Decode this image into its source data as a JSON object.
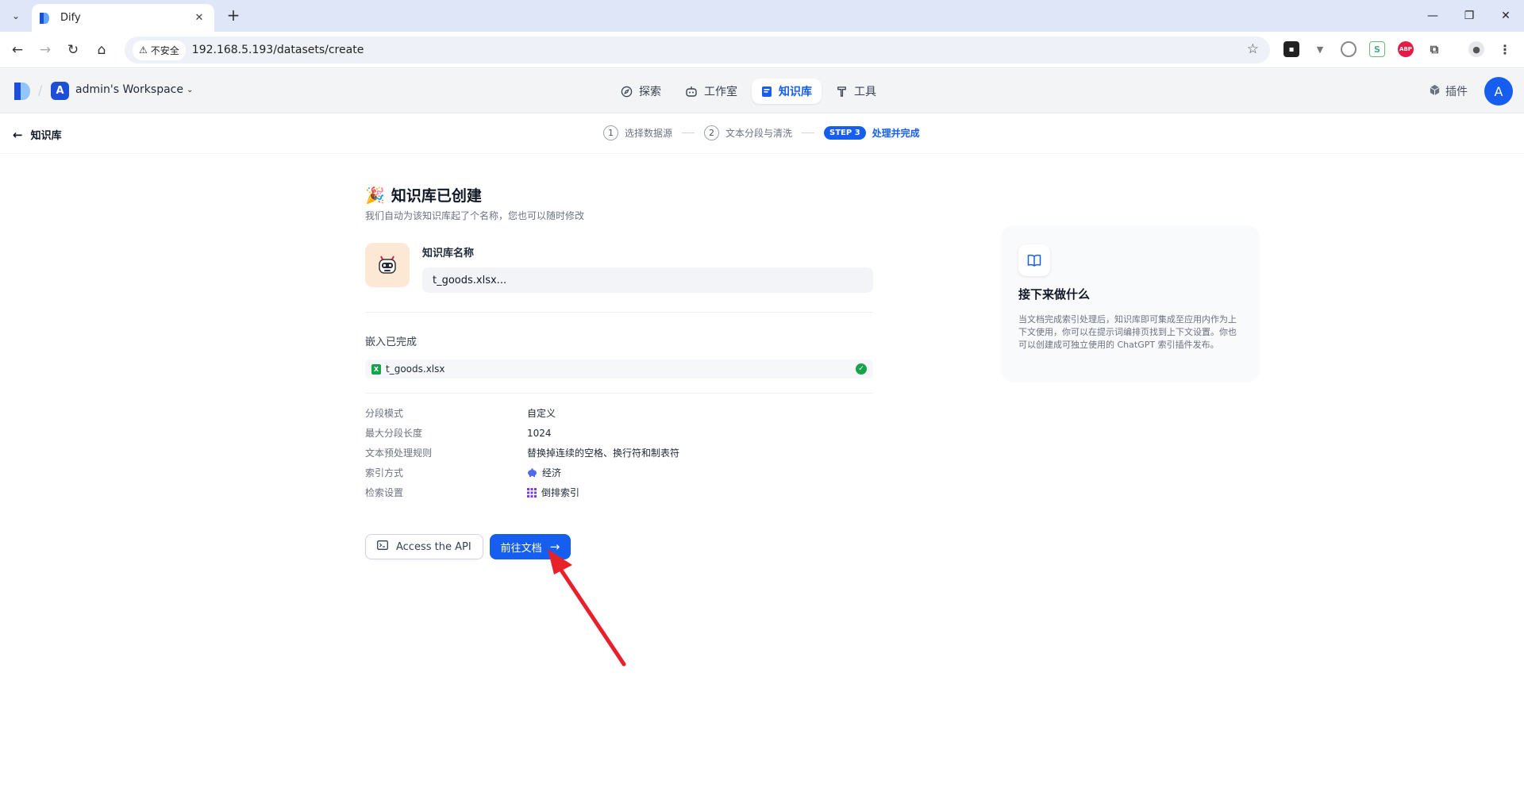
{
  "browser": {
    "tab_title": "Dify",
    "url": "192.168.5.193/datasets/create",
    "insecure_label": "不安全"
  },
  "header": {
    "workspace_initial": "A",
    "workspace_name": "admin's Workspace",
    "nav": [
      {
        "label": "探索",
        "icon": "compass-icon"
      },
      {
        "label": "工作室",
        "icon": "robot-icon"
      },
      {
        "label": "知识库",
        "icon": "book-icon"
      },
      {
        "label": "工具",
        "icon": "hammer-icon"
      }
    ],
    "plugins_label": "插件",
    "user_initial": "A",
    "accent": "#155eef"
  },
  "stepbar": {
    "back_label": "知识库",
    "steps": [
      {
        "num": "1",
        "label": "选择数据源"
      },
      {
        "num": "2",
        "label": "文本分段与清洗"
      },
      {
        "num": "STEP 3",
        "label": "处理并完成"
      }
    ]
  },
  "main": {
    "title": "知识库已创建",
    "subtitle": "我们自动为该知识库起了个名称，您也可以随时修改",
    "name_label": "知识库名称",
    "name_value": "t_goods.xlsx...",
    "embed_title": "嵌入已完成",
    "file_name": "t_goods.xlsx",
    "properties": [
      {
        "key": "分段模式",
        "value": "自定义"
      },
      {
        "key": "最大分段长度",
        "value": "1024"
      },
      {
        "key": "文本预处理规则",
        "value": "替换掉连续的空格、换行符和制表符"
      },
      {
        "key": "索引方式",
        "value": "经济"
      },
      {
        "key": "检索设置",
        "value": "倒排索引"
      }
    ],
    "api_button": "Access the API",
    "goto_button": "前往文档"
  },
  "side": {
    "title": "接下来做什么",
    "text": "当文档完成索引处理后，知识库即可集成至应用内作为上下文使用，你可以在提示词编排页找到上下文设置。你也可以创建成可独立使用的 ChatGPT 索引插件发布。"
  }
}
